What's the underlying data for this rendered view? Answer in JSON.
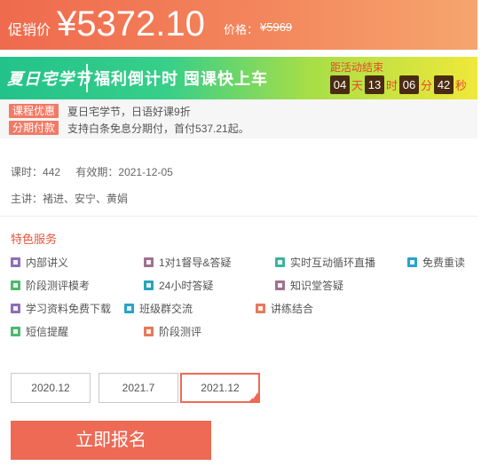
{
  "price": {
    "label": "促销价",
    "value": "¥5372.10",
    "list_label": "价格：",
    "list_value": "¥5969"
  },
  "promo": {
    "event": "夏日宅学节",
    "slogan": "福利倒计时 囤课快上车",
    "countdown_label": "距活动结束",
    "countdown": [
      {
        "value": "04",
        "unit": "天"
      },
      {
        "value": "13",
        "unit": "时"
      },
      {
        "value": "06",
        "unit": "分"
      },
      {
        "value": "42",
        "unit": "秒"
      }
    ]
  },
  "offers": [
    {
      "tag": "课程优惠",
      "text": "夏日宅学节，日语好课9折"
    },
    {
      "tag": "分期付款",
      "text": "支持白条免息分期付，首付537.21起。"
    }
  ],
  "info": {
    "hours_label": "课时：",
    "hours_value": "442",
    "expiry_label": "有效期：",
    "expiry_value": "2021-12-05",
    "teacher_label": "主讲：",
    "teacher_value": "褚进、安宁、黄娟"
  },
  "services_title": "特色服务",
  "services": [
    {
      "label": "内部讲义",
      "icon": "document-icon",
      "color": "#8b6fb8"
    },
    {
      "label": "1对1督导&答疑",
      "icon": "person-icon",
      "color": "#a0708f"
    },
    {
      "label": "实时互动循环直播",
      "icon": "monitor-icon",
      "color": "#3db39e"
    },
    {
      "label": "免费重读",
      "icon": "star-icon",
      "color": "#2aa3c9"
    },
    {
      "label": "阶段测评模考",
      "icon": "exam-icon",
      "color": "#4cb96d"
    },
    {
      "label": "24小时答疑",
      "icon": "clock-24-icon",
      "color": "#2aa3b8"
    },
    {
      "label": "知识堂答疑",
      "icon": "question-icon",
      "color": "#a0708f"
    },
    {
      "label": "学习资料免费下载",
      "icon": "download-icon",
      "color": "#8b6fb8"
    },
    {
      "label": "班级群交流",
      "icon": "chat-icon",
      "color": "#2aa3c9"
    },
    {
      "label": "讲练结合",
      "icon": "edit-icon",
      "color": "#e8785a"
    },
    {
      "label": "短信提醒",
      "icon": "message-icon",
      "color": "#4cb96d"
    },
    {
      "label": "阶段测评",
      "icon": "chart-icon",
      "color": "#e8785a"
    }
  ],
  "dates": [
    "2020.12",
    "2021.7",
    "2021.12"
  ],
  "selected_date": "2021.12",
  "enroll_label": "立即报名",
  "colors": {
    "accent": "#ee6a55",
    "promo_green": "#37cf89",
    "countdown_box": "#4a2b12"
  }
}
